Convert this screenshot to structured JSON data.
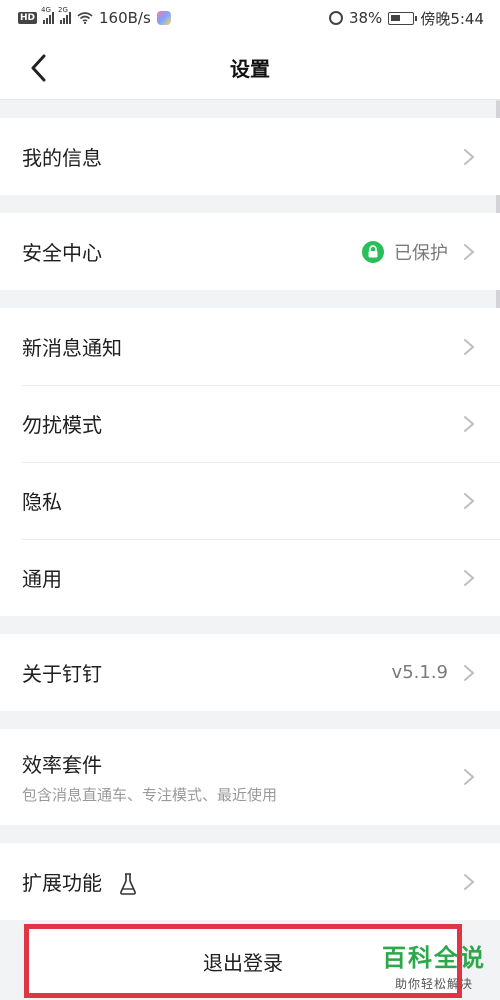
{
  "status_bar": {
    "hd": "HD",
    "signal1": "4G",
    "signal2": "2G",
    "speed": "160B/s",
    "battery": "38%",
    "time": "傍晚5:44"
  },
  "nav": {
    "title": "设置"
  },
  "groups": [
    {
      "items": [
        {
          "label": "我的信息"
        }
      ]
    },
    {
      "items": [
        {
          "label": "安全中心",
          "value": "已保护"
        }
      ]
    },
    {
      "items": [
        {
          "label": "新消息通知"
        },
        {
          "label": "勿扰模式"
        },
        {
          "label": "隐私"
        },
        {
          "label": "通用"
        }
      ]
    },
    {
      "items": [
        {
          "label": "关于钉钉",
          "value": "v5.1.9"
        }
      ]
    },
    {
      "items": [
        {
          "label": "效率套件",
          "sub": "包含消息直通车、专注模式、最近使用"
        }
      ]
    },
    {
      "items": [
        {
          "label": "扩展功能"
        }
      ]
    }
  ],
  "logout": {
    "label": "退出登录"
  },
  "watermark": {
    "title": "百科全说",
    "subtitle": "助你轻松解决"
  },
  "colors": {
    "accent_green": "#2bbf5b",
    "highlight_red": "#e03545",
    "background": "#f2f3f5"
  },
  "icons": {
    "back": "chevron-left-icon",
    "row_arrow": "chevron-right-icon",
    "security": "lock-icon",
    "extension": "flask-icon"
  }
}
